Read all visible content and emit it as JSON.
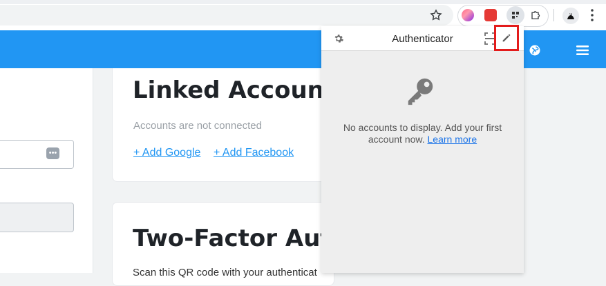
{
  "page": {
    "linked_accounts": {
      "title": "Linked Accounts",
      "status": "Accounts are not connected",
      "add_google": "+ Add Google",
      "add_facebook": "+ Add Facebook"
    },
    "two_factor": {
      "title": "Two-Factor Auth",
      "scan_text": "Scan this QR code with your authenticat"
    }
  },
  "popup": {
    "title": "Authenticator",
    "empty_message": "No accounts to display. Add your first account now.",
    "learn_more": "Learn more"
  },
  "colors": {
    "header_blue": "#2196f3",
    "link_blue": "#2196f3",
    "highlight_red": "#e31b1b"
  },
  "icons": [
    "star-icon",
    "extension-icon",
    "profile-icon",
    "more-vert-icon",
    "globe-icon",
    "menu-icon",
    "gear-icon",
    "scan-icon",
    "edit-icon",
    "key-icon"
  ]
}
